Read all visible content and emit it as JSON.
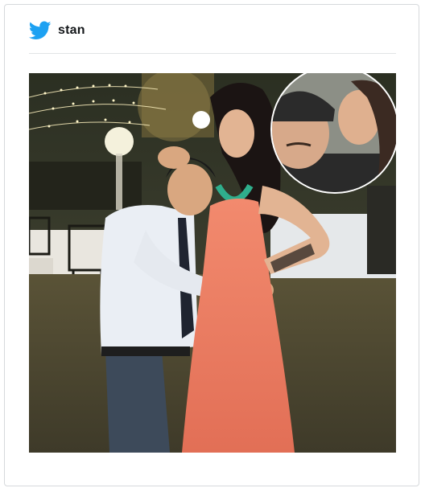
{
  "header": {
    "icon": "twitter-bird-icon",
    "username": "stan",
    "accent_color": "#1da1f2"
  },
  "post": {
    "image": "photo-of-man-and-woman-at-outdoor-party-with-kiss-inset"
  }
}
